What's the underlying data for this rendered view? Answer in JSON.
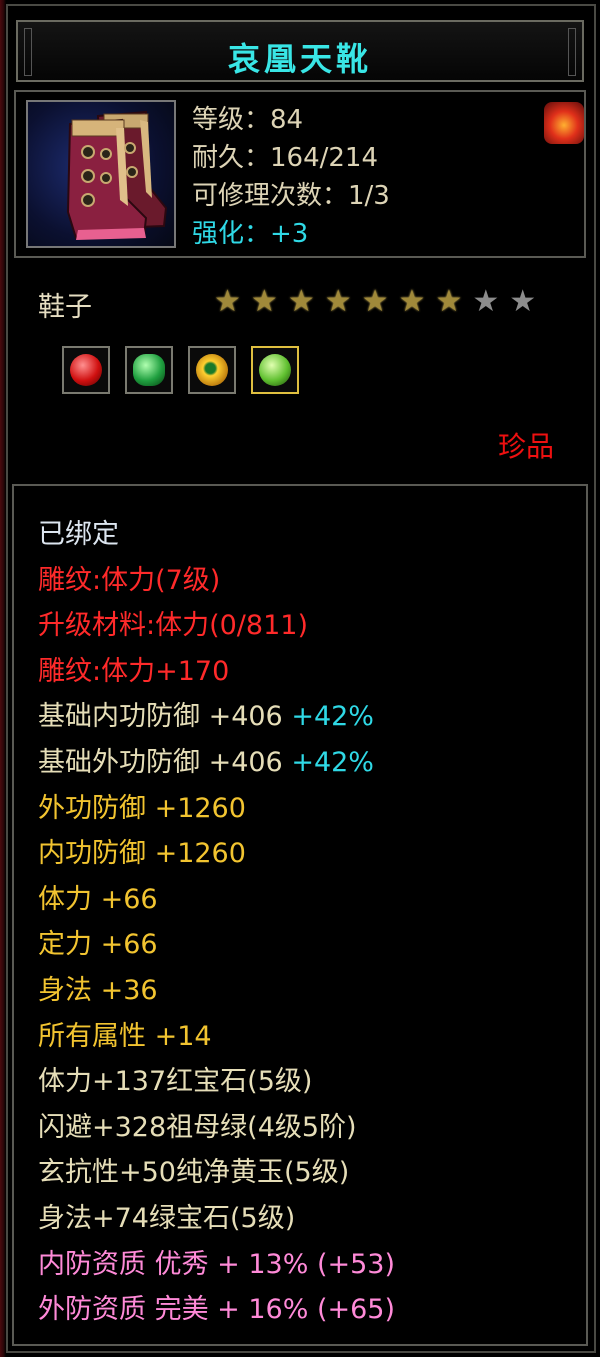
{
  "item": {
    "name": "哀凰天靴",
    "stats": {
      "level": "等级：84",
      "durability": "耐久：164/214",
      "repairs": "可修理次数：1/3",
      "enhance": "强化：+3"
    },
    "type": "鞋子",
    "stars": {
      "filled": 7,
      "total": 9
    },
    "gems": [
      {
        "icon": "red-gem-icon",
        "color": "#d01010"
      },
      {
        "icon": "emerald-gem-icon",
        "color": "#20a040"
      },
      {
        "icon": "yellow-jade-gem-icon",
        "color": "#ffd030"
      },
      {
        "icon": "green-gem-icon",
        "color": "#60c030"
      }
    ],
    "rarity": "珍品",
    "badge_icon": "fire-badge-icon"
  },
  "attributes": {
    "bound": "已绑定",
    "engrave_level": "雕纹:体力(7级)",
    "upgrade_material": "升级材料:体力(0/811)",
    "engrave_bonus": "雕纹:体力+170",
    "base_inner_def": {
      "label": "基础内功防御 +406 ",
      "extra": "+42%"
    },
    "base_outer_def": {
      "label": "基础外功防御 +406 ",
      "extra": "+42%"
    },
    "outer_def": "外功防御 +1260",
    "inner_def": "内功防御 +1260",
    "stamina": "体力 +66",
    "focus": "定力 +66",
    "agility": "身法 +36",
    "all_attrs": "所有属性 +14",
    "gem_line_1": "体力+137红宝石(5级)",
    "gem_line_2": "闪避+328祖母绿(4级5阶)",
    "gem_line_3": "玄抗性+50纯净黄玉(5级)",
    "gem_line_4": "身法+74绿宝石(5级)",
    "inner_quality": "内防资质 优秀 + 13% (+53)",
    "outer_quality": "外防资质 完美 + 16% (+65)"
  },
  "colors": {
    "title": "#39e6e6",
    "red": "#ff2a2a",
    "gold": "#f2c430",
    "cyan": "#2fd9e6",
    "pink": "#ff8ad8"
  }
}
